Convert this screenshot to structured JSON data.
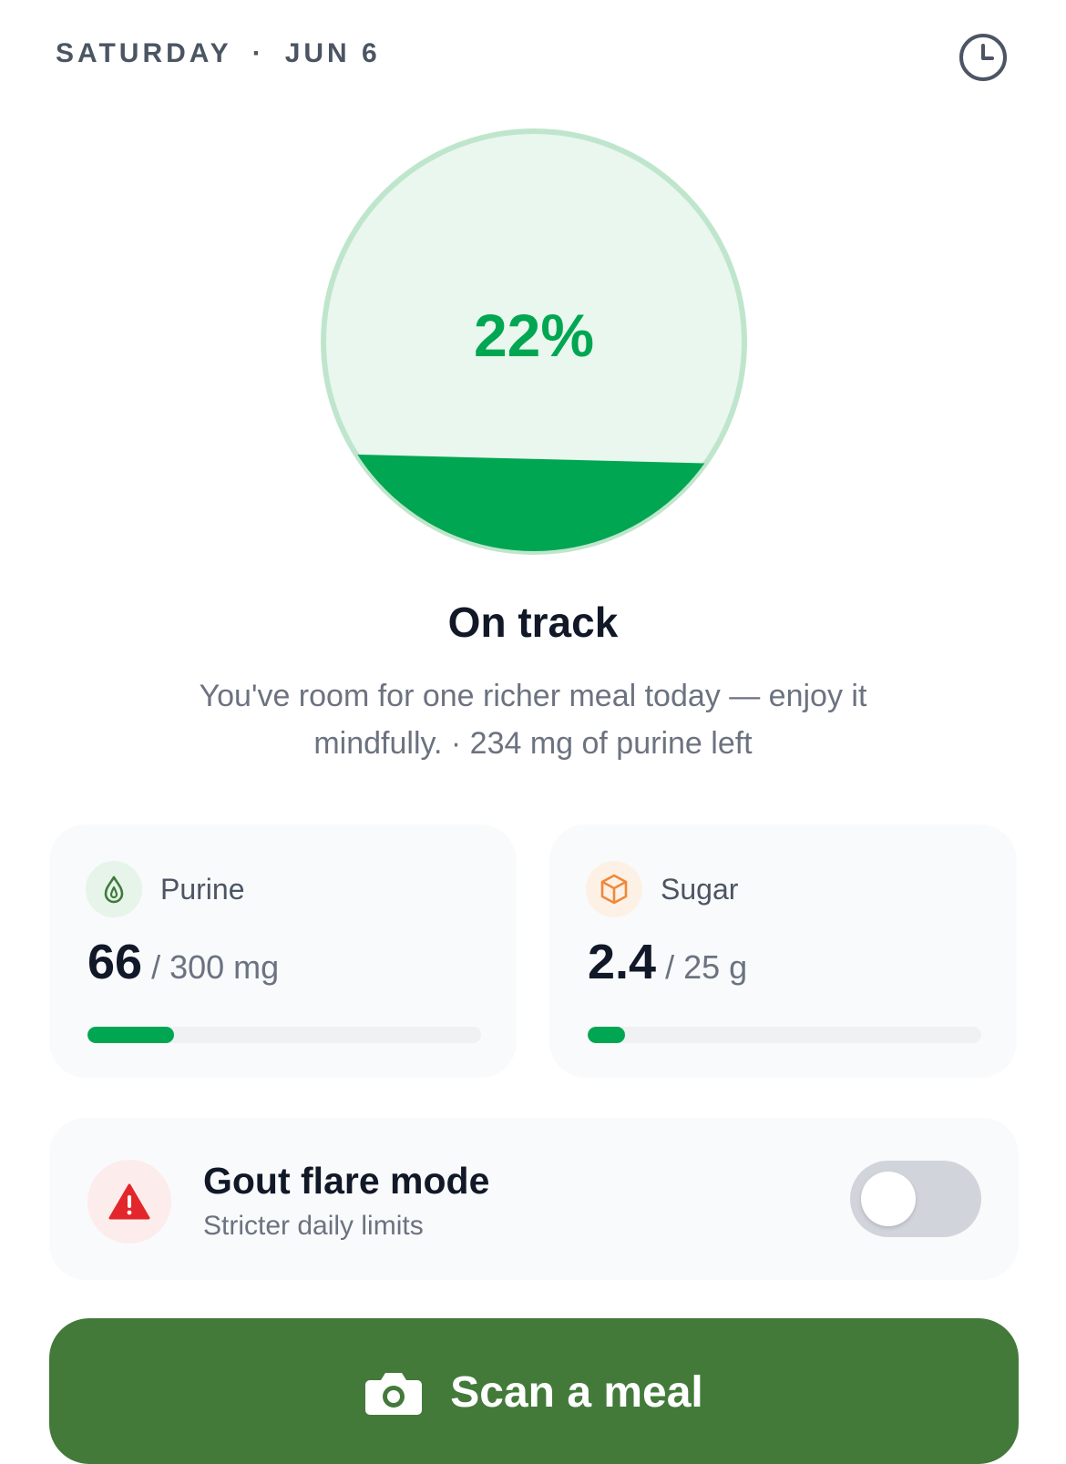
{
  "header": {
    "day": "SATURDAY",
    "separator": "·",
    "date": "JUN 6",
    "history_icon": "clock-icon"
  },
  "gauge": {
    "percent_label": "22%",
    "fill_fraction": 0.22,
    "colors": {
      "fill": "#00a651",
      "background": "#e9f7ee",
      "border": "#bfe6cc",
      "text": "#00a651"
    }
  },
  "status": {
    "title": "On track",
    "description": "You've room for one richer meal today — enjoy it mindfully. · 234 mg of purine left"
  },
  "metrics": {
    "purine": {
      "icon": "droplet-icon",
      "label": "Purine",
      "value": "66",
      "limit": "/ 300 mg",
      "progress": 0.22
    },
    "sugar": {
      "icon": "cube-icon",
      "label": "Sugar",
      "value": "2.4",
      "limit": "/ 25 g",
      "progress": 0.096
    }
  },
  "flare_mode": {
    "icon": "warning-icon",
    "title": "Gout flare mode",
    "subtitle": "Stricter daily limits",
    "enabled": false
  },
  "scan_button": {
    "icon": "camera-icon",
    "label": "Scan a meal",
    "color": "#437a3a"
  }
}
